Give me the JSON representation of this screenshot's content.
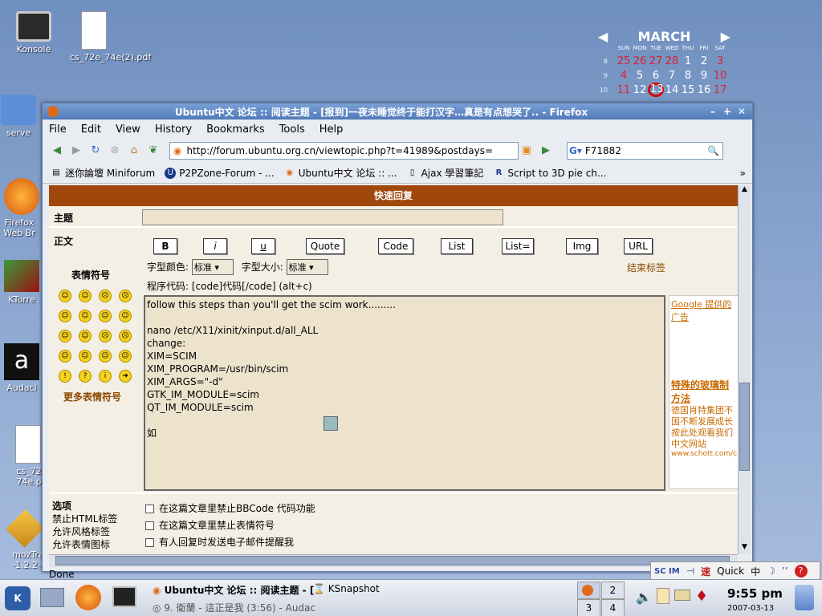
{
  "desktop": {
    "icons": [
      {
        "label": "Konsole",
        "icon": "monitor-icon"
      },
      {
        "label": "cs_72e_74e(2).pdf",
        "icon": "document-icon"
      },
      {
        "label": "serve",
        "icon": "folder-icon"
      },
      {
        "label": "Firefox Web Br",
        "icon": "firefox-icon"
      },
      {
        "label": "KTorre",
        "icon": "ktorrent-icon"
      },
      {
        "label": "Audaci",
        "icon": "audacity-icon"
      },
      {
        "label": "cs_72 74e.p",
        "icon": "document-icon"
      },
      {
        "label": "mozTra -1.2.2-t",
        "icon": "package-icon"
      }
    ]
  },
  "calendar": {
    "month": "MARCH",
    "days": [
      "SUN",
      "MON",
      "TUE",
      "WED",
      "THU",
      "FRI",
      "SAT"
    ],
    "weeks": [
      {
        "wk": "8",
        "days": [
          "25",
          "26",
          "27",
          "28",
          "1",
          "2",
          "3"
        ]
      },
      {
        "wk": "9",
        "days": [
          "4",
          "5",
          "6",
          "7",
          "8",
          "9",
          "10"
        ]
      },
      {
        "wk": "10",
        "days": [
          "11",
          "12",
          "13",
          "14",
          "15",
          "16",
          "17"
        ]
      }
    ],
    "today": "13"
  },
  "window": {
    "title": "Ubuntu中文 论坛 :: 阅读主题 - [报到]一夜未睡觉终于能打汉字…真是有点想哭了.. - Firefox",
    "menu": [
      "File",
      "Edit",
      "View",
      "History",
      "Bookmarks",
      "Tools",
      "Help"
    ],
    "url": "http://forum.ubuntu.org.cn/viewtopic.php?t=41989&postdays=",
    "search_value": "F71882",
    "bookmarks": [
      "迷你論壇 Miniforum",
      "P2PZone-Forum - ...",
      "Ubuntu中文 论坛 :: ...",
      "Ajax 學習筆記",
      "Script to 3D pie ch..."
    ],
    "status": "Done"
  },
  "form": {
    "header": "快速回复",
    "subject_label": "主题",
    "body_label": "正文",
    "buttons": [
      "B",
      "i",
      "u",
      "Quote",
      "Code",
      "List",
      "List=",
      "Img",
      "URL"
    ],
    "color_label": "字型颜色:",
    "color_value": "标准",
    "size_label": "字型大小:",
    "size_value": "标准",
    "close_tags": "结束标签",
    "code_hint": "程序代码: [code]代码[/code]  (alt+c)",
    "emoticons_label": "表情符号",
    "more_emoticons": "更多表情符号",
    "message_lines": [
      "follow this steps than you'll get the scim work.........",
      "",
      "nano /etc/X11/xinit/xinput.d/all_ALL",
      "change:",
      "XIM=SCIM",
      "XIM_PROGRAM=/usr/bin/scim",
      "XIM_ARGS=\"-d\"",
      "GTK_IM_MODULE=scim",
      "QT_IM_MODULE=scim",
      "",
      "如"
    ],
    "options_label": "选项",
    "option_notes": [
      "禁止HTML标签",
      "允许风格标签",
      "允许表情图标"
    ],
    "checkboxes": [
      "在这篇文章里禁止BBCode 代码功能",
      "在这篇文章里禁止表情符号",
      "有人回复时发送电子邮件提醒我"
    ]
  },
  "ad": {
    "header": "Google 提供的广告",
    "title": "特殊的玻璃制 方法",
    "body": "德国肖特集团不 国不断发展成长 按此处观看我们 中文网站",
    "url": "www.schott.com/c"
  },
  "taskbar": {
    "tasks": [
      "Ubuntu中文 论坛 :: 阅读主题 - [",
      "KSnapshot",
      "9. 衛蘭 - 這正是我 (3:56) - Audac"
    ],
    "pager": [
      "1",
      "2",
      "3",
      "4"
    ],
    "time": "9:55 pm",
    "date": "2007-03-13"
  },
  "scim": {
    "mode": "Quick",
    "lang": "中"
  }
}
